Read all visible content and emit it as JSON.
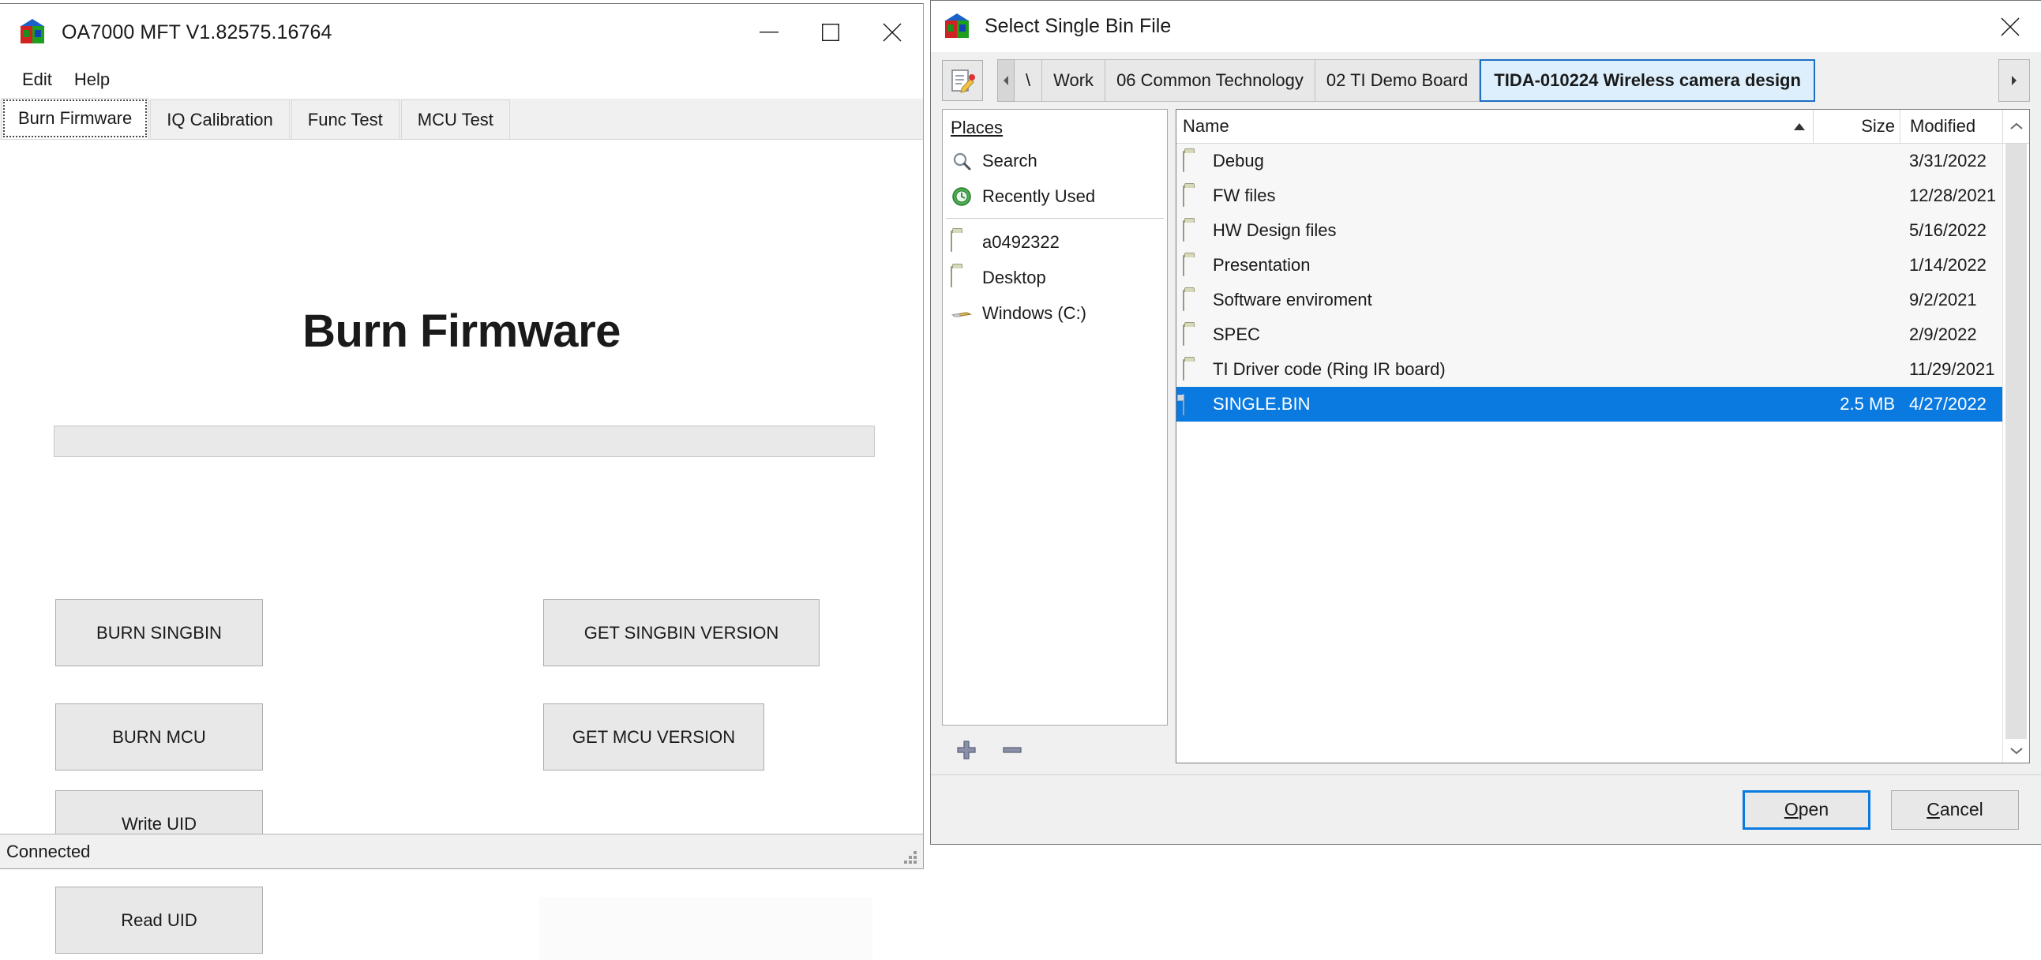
{
  "app": {
    "title": "OA7000 MFT V1.82575.16764",
    "icon": "qt-cube-icon",
    "window_controls": [
      {
        "name": "minimize-button",
        "glyph": "minimize-icon"
      },
      {
        "name": "maximize-button",
        "glyph": "maximize-icon"
      },
      {
        "name": "close-button",
        "glyph": "close-icon"
      }
    ],
    "menu": [
      {
        "label": "Edit"
      },
      {
        "label": "Help"
      }
    ],
    "tabs": [
      {
        "label": "Burn Firmware",
        "selected": true
      },
      {
        "label": "IQ Calibration",
        "selected": false
      },
      {
        "label": "Func Test",
        "selected": false
      },
      {
        "label": "MCU Test",
        "selected": false
      }
    ],
    "page": {
      "heading": "Burn Firmware",
      "progress_percent": 0,
      "buttons": {
        "burn_singbin": "BURN SINGBIN",
        "burn_mcu": "BURN MCU",
        "write_uid": "Write UID",
        "read_uid": "Read UID",
        "get_singbin_version": "GET SINGBIN VERSION",
        "get_mcu_version": "GET MCU VERSION"
      }
    },
    "status": "Connected"
  },
  "dialog": {
    "title": "Select Single Bin File",
    "icon": "qt-cube-icon",
    "close_label": "close-icon",
    "toolbar": {
      "new_folder_icon": "new-folder-icon",
      "prev_arrow": "chevron-left-icon",
      "next_arrow": "chevron-right-icon"
    },
    "breadcrumbs": [
      {
        "label": "\\",
        "current": false
      },
      {
        "label": "Work",
        "current": false
      },
      {
        "label": "06 Common Technology",
        "current": false
      },
      {
        "label": "02 TI Demo Board",
        "current": false
      },
      {
        "label": "TIDA-010224 Wireless camera design",
        "current": true
      }
    ],
    "places": {
      "header": "Places",
      "header_mnemonic": "P",
      "header_rest": "laces",
      "items": [
        {
          "label": "Search",
          "icon": "search-icon"
        },
        {
          "label": "Recently Used",
          "icon": "recent-clock-icon"
        }
      ],
      "locations": [
        {
          "label": "a0492322",
          "icon": "folder-icon"
        },
        {
          "label": "Desktop",
          "icon": "folder-icon"
        },
        {
          "label": "Windows (C:)",
          "icon": "drive-icon"
        }
      ],
      "tools": [
        {
          "name": "add-place-button",
          "icon": "plus-icon"
        },
        {
          "name": "remove-place-button",
          "icon": "minus-icon"
        }
      ]
    },
    "files": {
      "columns": [
        "Name",
        "Size",
        "Modified"
      ],
      "sort_column": "Name",
      "sort_direction": "ascending",
      "rows": [
        {
          "name": "Debug",
          "size": "",
          "modified": "3/31/2022",
          "icon": "folder-icon",
          "selected": false
        },
        {
          "name": "FW files",
          "size": "",
          "modified": "12/28/2021",
          "icon": "folder-icon",
          "selected": false
        },
        {
          "name": "HW Design files",
          "size": "",
          "modified": "5/16/2022",
          "icon": "folder-icon",
          "selected": false
        },
        {
          "name": "Presentation",
          "size": "",
          "modified": "1/14/2022",
          "icon": "folder-icon",
          "selected": false
        },
        {
          "name": "Software enviroment",
          "size": "",
          "modified": "9/2/2021",
          "icon": "folder-icon",
          "selected": false
        },
        {
          "name": "SPEC",
          "size": "",
          "modified": "2/9/2022",
          "icon": "folder-icon",
          "selected": false
        },
        {
          "name": "TI Driver code (Ring IR board)",
          "size": "",
          "modified": "11/29/2021",
          "icon": "folder-icon",
          "selected": false
        },
        {
          "name": "SINGLE.BIN",
          "size": "2.5 MB",
          "modified": "4/27/2022",
          "icon": "file-icon",
          "selected": true
        }
      ]
    },
    "footer": {
      "open": {
        "mnemonic": "O",
        "rest": "pen",
        "default": true
      },
      "cancel": {
        "mnemonic": "C",
        "rest": "ancel",
        "default": false
      }
    }
  },
  "colors": {
    "selection_blue": "#0a7ae0",
    "crumb_active_bg": "#ddeffc",
    "crumb_active_border": "#1e6fc4",
    "window_bg": "#f0f0f0"
  }
}
